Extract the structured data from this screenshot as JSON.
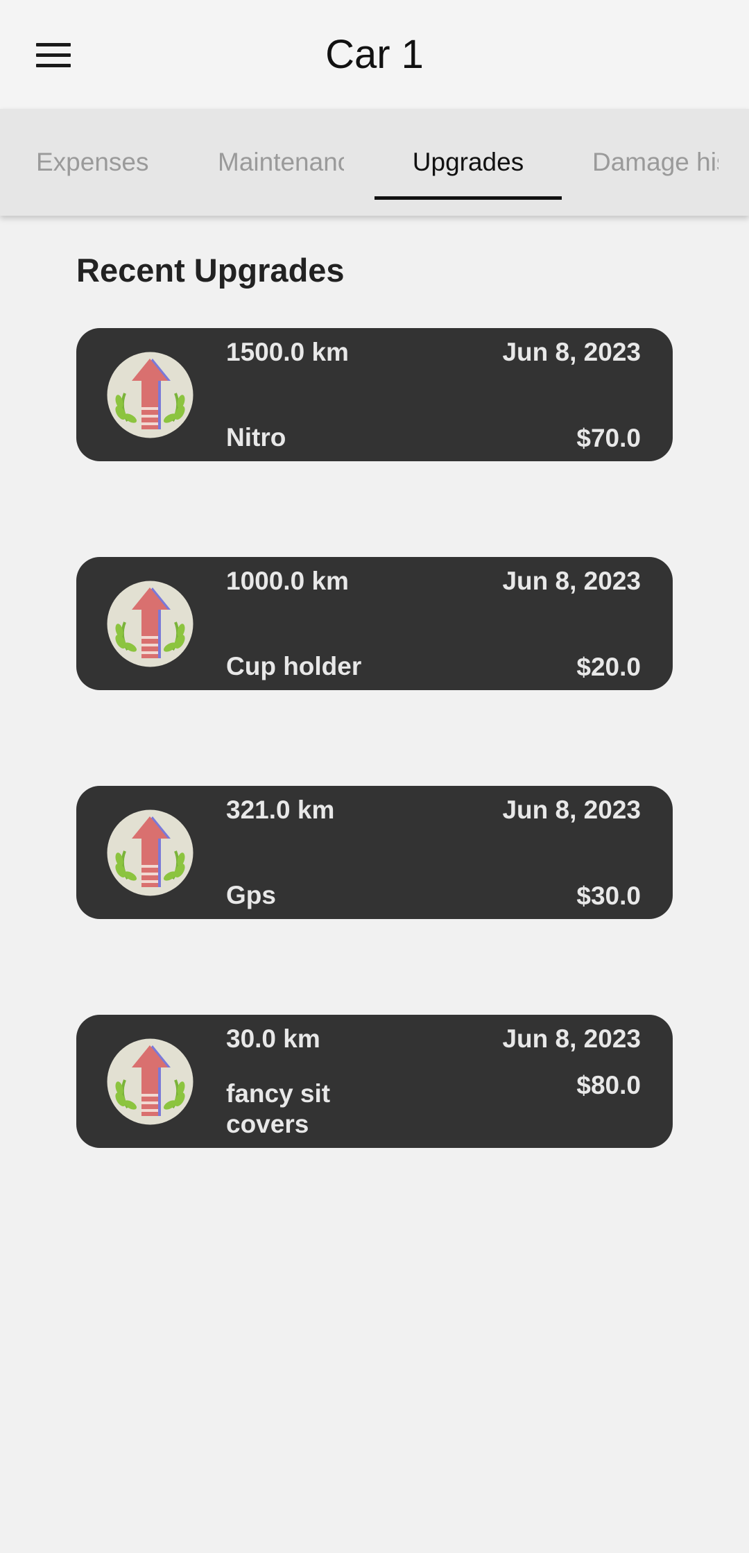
{
  "app_bar": {
    "title": "Car 1",
    "menu_icon": "hamburger-menu-icon"
  },
  "tabs": [
    {
      "label": "Expenses",
      "active": false
    },
    {
      "label": "Maintenance",
      "active": false
    },
    {
      "label": "Upgrades",
      "active": true
    },
    {
      "label": "Damage history",
      "active": false
    }
  ],
  "section": {
    "title": "Recent Upgrades"
  },
  "upgrades": [
    {
      "km": "1500.0 km",
      "date": "Jun 8, 2023",
      "name": "Nitro",
      "cost": "$70.0",
      "icon": "upgrade-arrow-icon"
    },
    {
      "km": "1000.0 km",
      "date": "Jun 8, 2023",
      "name": "Cup holder",
      "cost": "$20.0",
      "icon": "upgrade-arrow-icon"
    },
    {
      "km": "321.0 km",
      "date": "Jun 8, 2023",
      "name": "Gps",
      "cost": "$30.0",
      "icon": "upgrade-arrow-icon"
    },
    {
      "km": "30.0 km",
      "date": "Jun 8, 2023",
      "name": "fancy sit covers",
      "cost": "$80.0",
      "icon": "upgrade-arrow-icon"
    }
  ],
  "colors": {
    "background": "#f1f1f1",
    "card": "#333333",
    "card_text": "#e8e8e8",
    "tab_bar": "#e6e6e6",
    "tab_inactive": "#9a9a9a",
    "tab_active": "#111111",
    "arrow": "#d9706f",
    "laurel": "#8cc43f"
  }
}
